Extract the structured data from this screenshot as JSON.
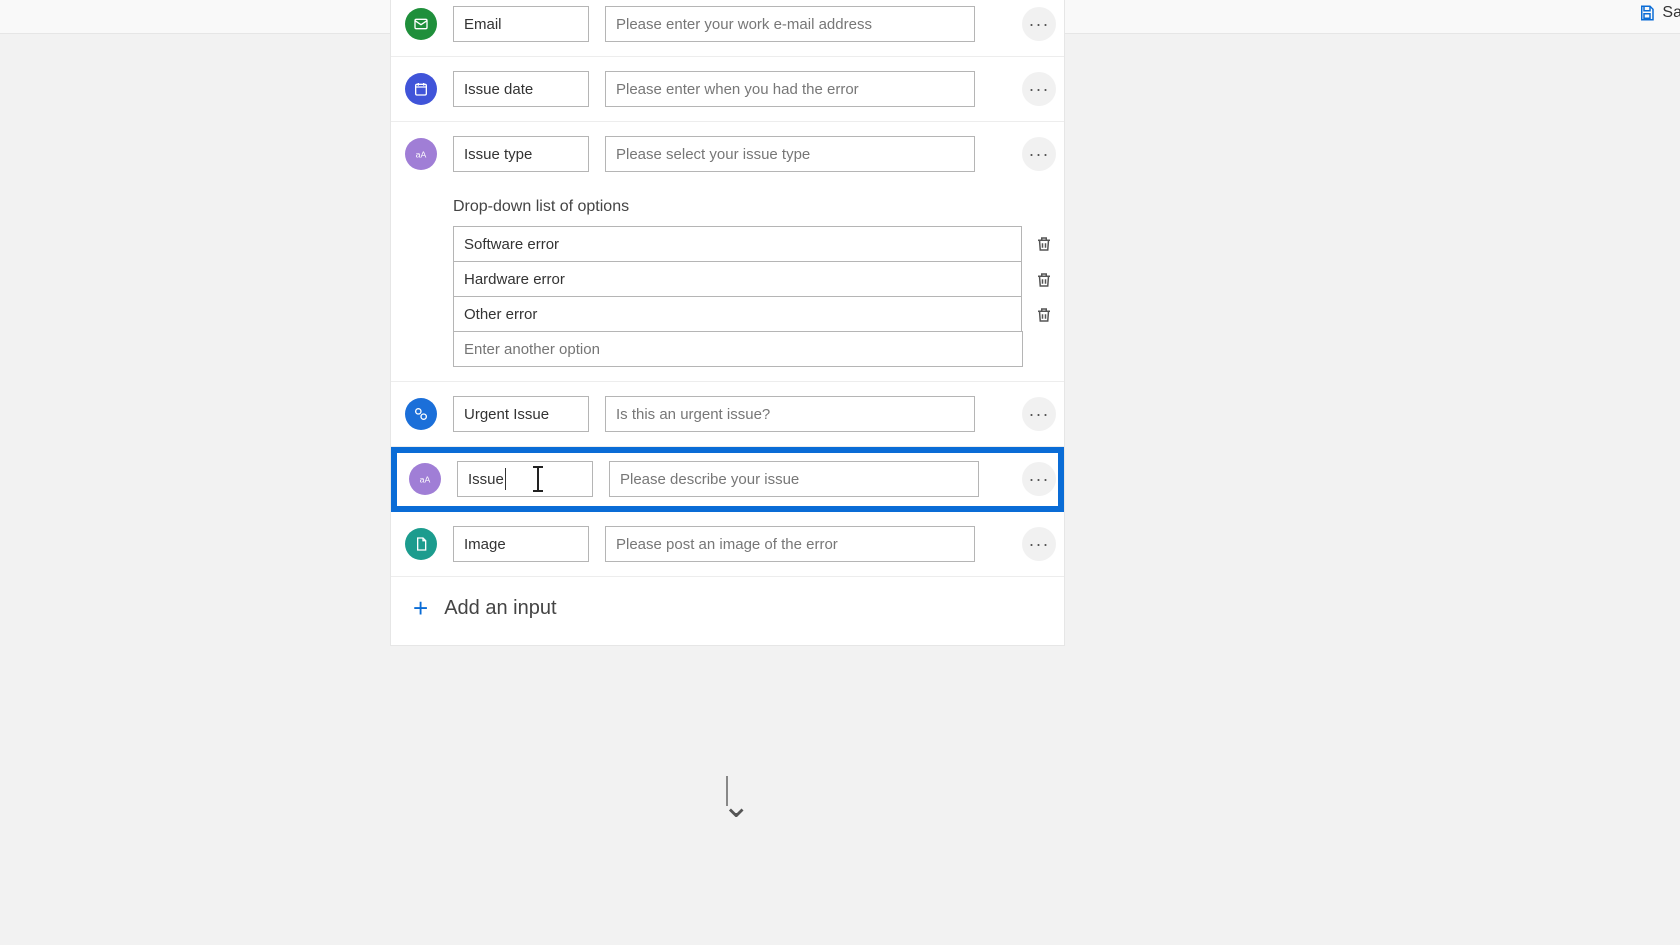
{
  "topbar": {
    "save_label": "Sav"
  },
  "rows": [
    {
      "id": "email",
      "icon_bg": "#1f8f3b",
      "name": "Email",
      "placeholder": "Please enter your work e-mail address"
    },
    {
      "id": "issue-date",
      "icon_bg": "#4054d9",
      "name": "Issue date",
      "placeholder": "Please enter when you had the error"
    },
    {
      "id": "issue-type",
      "icon_bg": "#a07ed6",
      "name": "Issue type",
      "placeholder": "Please select your issue type",
      "dropdown": {
        "title": "Drop-down list of options",
        "options": [
          "Software error",
          "Hardware error",
          "Other error"
        ],
        "add_placeholder": "Enter another option"
      }
    },
    {
      "id": "urgent-issue",
      "icon_bg": "#1b6fd9",
      "name": "Urgent Issue",
      "placeholder": "Is this an urgent issue?"
    },
    {
      "id": "issue-desc",
      "icon_bg": "#a07ed6",
      "name": "Issue",
      "placeholder": "Please describe your issue",
      "selected": true
    },
    {
      "id": "image",
      "icon_bg": "#1c9c8e",
      "name": "Image",
      "placeholder": "Please post an image of the error"
    }
  ],
  "add_input_label": "Add an input",
  "more_glyph": "···"
}
